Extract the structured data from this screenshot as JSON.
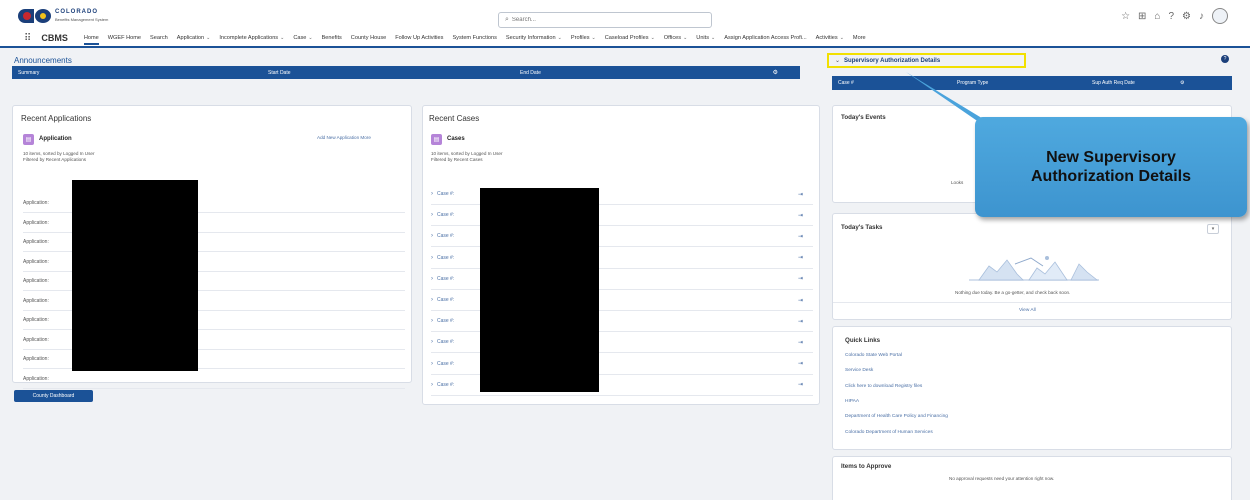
{
  "header": {
    "logo_line1": "COLORADO",
    "logo_line2": "Benefits Management System",
    "search_placeholder": "Search...",
    "app_name": "CBMS",
    "nav": [
      {
        "label": "Home",
        "active": true,
        "dropdown": false
      },
      {
        "label": "WGEF Home",
        "dropdown": false
      },
      {
        "label": "Search",
        "dropdown": false
      },
      {
        "label": "Application",
        "dropdown": true
      },
      {
        "label": "Incomplete Applications",
        "dropdown": true
      },
      {
        "label": "Case",
        "dropdown": true
      },
      {
        "label": "Benefits",
        "dropdown": false
      },
      {
        "label": "County House",
        "dropdown": false
      },
      {
        "label": "Follow Up Activities",
        "dropdown": false
      },
      {
        "label": "System Functions",
        "dropdown": false
      },
      {
        "label": "Security Information",
        "dropdown": true
      },
      {
        "label": "Profiles",
        "dropdown": true
      },
      {
        "label": "Caseload Profiles",
        "dropdown": true
      },
      {
        "label": "Offices",
        "dropdown": true
      },
      {
        "label": "Units",
        "dropdown": true
      },
      {
        "label": "Assign Application Access Profi...",
        "dropdown": false
      },
      {
        "label": "Activities",
        "dropdown": true
      },
      {
        "label": "More",
        "dropdown": false
      }
    ]
  },
  "announcements": {
    "title": "Announcements",
    "columns": {
      "summary": "Summary",
      "start": "Start Date",
      "end": "End Date"
    }
  },
  "supervisory": {
    "title": "Supervisory Authorization Details",
    "columns": {
      "case": "Case #",
      "program": "Program Type",
      "date": "Sup Auth Req Date"
    }
  },
  "recent_applications": {
    "title": "Recent Applications",
    "object_label": "Application",
    "add_link": "Add New Application  More",
    "meta_line1": "10 items, sorted by Logged In User",
    "meta_line2": "Filtered by Recent Applications",
    "rows": [
      "Application:",
      "Application:",
      "Application:",
      "Application:",
      "Application:",
      "Application:",
      "Application:",
      "Application:",
      "Application:",
      "Application:"
    ]
  },
  "recent_cases": {
    "title": "Recent Cases",
    "object_label": "Cases",
    "meta_line1": "10 items, sorted by Logged In User",
    "meta_line2": "Filtered by Recent Cases",
    "rows": [
      "Case #:",
      "Case #:",
      "Case #:",
      "Case #:",
      "Case #:",
      "Case #:",
      "Case #:",
      "Case #:",
      "Case #:",
      "Case #:"
    ]
  },
  "county_dashboard_label": "County Dashboard",
  "events": {
    "title": "Today's Events",
    "message": "Looks"
  },
  "tasks": {
    "title": "Today's Tasks",
    "message": "Nothing due today. Be a go-getter, and check back soon.",
    "view_all": "View All"
  },
  "quick_links": {
    "title": "Quick Links",
    "links": [
      "Colorado State Web Portal",
      "Service Desk",
      "Click here to download Registry files",
      "HIPAA",
      "Department of Health Care Policy and Financing",
      "Colorado Department of Human Services"
    ]
  },
  "approve": {
    "title": "Items to Approve",
    "message": "No approval requests need your attention right now."
  },
  "callout": {
    "text": "New Supervisory Authorization Details",
    "color": "#4aa3dc"
  },
  "colors": {
    "brand": "#1b5297",
    "highlight": "#f2e000"
  },
  "icons": {
    "waffle": "app-launcher-icon",
    "search": "search-icon",
    "help": "help-icon",
    "setup": "gear-icon",
    "notifications": "bell-icon",
    "favorites": "star-icon"
  }
}
